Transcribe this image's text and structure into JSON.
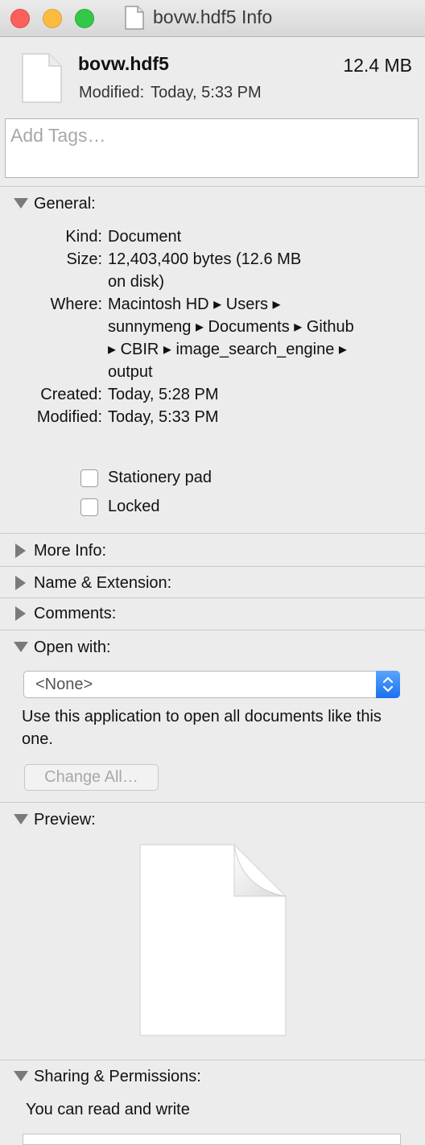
{
  "window": {
    "title": "bovw.hdf5 Info"
  },
  "header": {
    "file_name": "bovw.hdf5",
    "file_size": "12.4 MB",
    "modified_label": "Modified:",
    "modified_value": "Today, 5:33 PM"
  },
  "tags": {
    "placeholder": "Add Tags…"
  },
  "general": {
    "title": "General:",
    "kind_label": "Kind:",
    "kind_value": "Document",
    "size_label": "Size:",
    "size_value_line1": "12,403,400 bytes (12.6 MB",
    "size_value_line2": "on disk)",
    "where_label": "Where:",
    "where_line1": "Macintosh HD ▸ Users ▸",
    "where_line2": "sunnymeng ▸ Documents ▸ Github",
    "where_line3": "▸ CBIR ▸ image_search_engine ▸",
    "where_line4": "output",
    "created_label": "Created:",
    "created_value": "Today, 5:28 PM",
    "modified_label": "Modified:",
    "modified_value": "Today, 5:33 PM",
    "stationery_label": "Stationery pad",
    "locked_label": "Locked"
  },
  "sections": {
    "more_info": "More Info:",
    "name_extension": "Name & Extension:",
    "comments": "Comments:",
    "open_with": "Open with:",
    "preview": "Preview:",
    "sharing": "Sharing & Permissions:"
  },
  "open_with": {
    "selected": "<None>",
    "description": "Use this application to open all documents like this one.",
    "change_all_label": "Change All…"
  },
  "sharing": {
    "status": "You can read and write"
  },
  "colors": {
    "close": "#fc605c",
    "minimize": "#fdbc40",
    "zoom": "#34c84a",
    "accent": "#1b6ff0"
  }
}
